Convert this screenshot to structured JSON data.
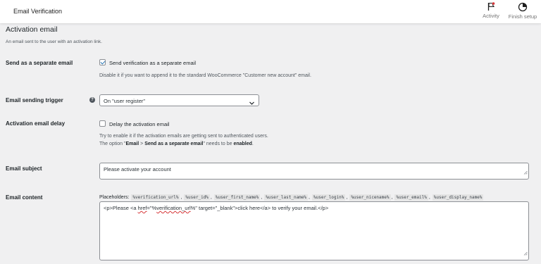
{
  "topbar": {
    "title": "Email Verification",
    "activity_label": "Activity",
    "finish_setup_label": "Finish setup",
    "activity_icon": "flag-icon",
    "finish_icon": "progress-circle-icon"
  },
  "section": {
    "title": "Activation email",
    "description": "An email sent to the user with an activation link."
  },
  "separate_email": {
    "label": "Send as a separate email",
    "checkbox_label": "Send verification as a separate email",
    "checked": true,
    "description": "Disable it if you want to append it to the standard WooCommerce \"Customer new account\" email."
  },
  "trigger": {
    "label": "Email sending trigger",
    "help_icon": "help-icon",
    "selected": "On \"user register\""
  },
  "delay": {
    "label": "Activation email delay",
    "checkbox_label": "Delay the activation email",
    "checked": false,
    "desc_line1": "Try to enable it if the activation emails are getting sent to authenticated users.",
    "desc_prefix": "The option \"",
    "desc_bold1": "Email",
    "desc_mid1": " > ",
    "desc_bold2": "Send as a separate email",
    "desc_mid2": "\" needs to be ",
    "desc_bold3": "enabled",
    "desc_suffix": "."
  },
  "subject": {
    "label": "Email subject",
    "value": "Please activate your account"
  },
  "content": {
    "label": "Email content",
    "placeholders_label": "Placeholders:",
    "placeholders": [
      "%verification_url%",
      "%user_id%",
      "%user_first_name%",
      "%user_last_name%",
      "%user_login%",
      "%user_nicename%",
      "%user_email%",
      "%user_display_name%"
    ],
    "value_part1": "<p>Please <a ",
    "value_href": "href",
    "value_part2": "=\"%",
    "value_url": "verification_url",
    "value_part3": "%\" target=\"_blank\">click here</a> to verify your email.</p>"
  },
  "colors": {
    "background": "#f0f0f1",
    "checkbox_accent": "#2271b1",
    "flag_accent": "#d63638"
  }
}
